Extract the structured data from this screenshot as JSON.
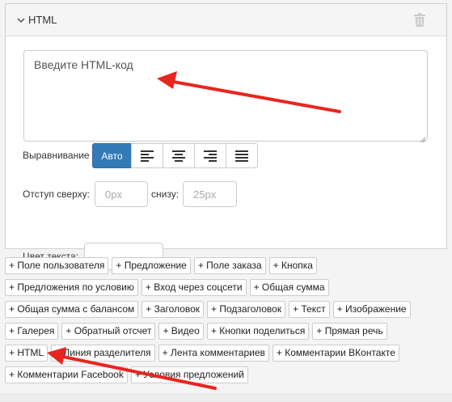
{
  "panel": {
    "title": "HTML",
    "html_placeholder": "Введите HTML-код"
  },
  "alignment": {
    "label": "Выравнивание",
    "auto_label": "Авто",
    "options": [
      "align-left",
      "align-center",
      "align-right",
      "align-justify"
    ]
  },
  "indent": {
    "top_label": "Отступ сверху:",
    "top_placeholder": "0px",
    "bottom_label": "снизу:",
    "bottom_placeholder": "25px"
  },
  "text_color": {
    "label": "Цвет текста:"
  },
  "elements": {
    "rows": [
      [
        "+ Поле пользователя",
        "+ Предложение",
        "+ Поле заказа",
        "+ Кнопка"
      ],
      [
        "+ Предложения по условию",
        "+ Вход через соцсети",
        "+ Общая сумма"
      ],
      [
        "+ Общая сумма с балансом",
        "+ Заголовок",
        "+ Подзаголовок",
        "+ Текст",
        "+ Изображение"
      ],
      [
        "+ Галерея",
        "+ Обратный отсчет",
        "+ Видео",
        "+ Кнопки поделиться",
        "+ Прямая речь"
      ],
      [
        "+ HTML",
        "+ Линия разделителя",
        "+ Лента комментариев",
        "+ Комментарии ВКонтакте"
      ],
      [
        "+ Комментарии Facebook",
        "+ Условия предложений"
      ]
    ]
  },
  "colors": {
    "accent": "#337ab7",
    "arrow": "#e8251f"
  }
}
